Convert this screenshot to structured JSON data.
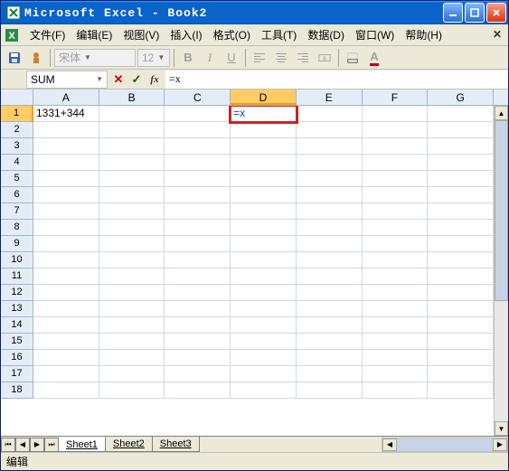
{
  "window": {
    "title": "Microsoft Excel - Book2"
  },
  "menu": {
    "file": "文件(F)",
    "edit": "编辑(E)",
    "view": "视图(V)",
    "insert": "插入(I)",
    "format": "格式(O)",
    "tools": "工具(T)",
    "data": "数据(D)",
    "windowm": "窗口(W)",
    "help": "帮助(H)"
  },
  "toolbar": {
    "font_name": "宋体",
    "font_size": "12",
    "bold": "B",
    "italic": "I",
    "underlinel": "U",
    "fontA": "A"
  },
  "formulabar": {
    "namebox": "SUM",
    "cancel": "✕",
    "accept": "✓",
    "fx": "fx",
    "formula": "=x"
  },
  "columns": [
    "A",
    "B",
    "C",
    "D",
    "E",
    "F",
    "G"
  ],
  "rows": [
    1,
    2,
    3,
    4,
    5,
    6,
    7,
    8,
    9,
    10,
    11,
    12,
    13,
    14,
    15,
    16,
    17,
    18
  ],
  "cells": {
    "A1": "1331+344",
    "D1": "=x"
  },
  "active_cell": "D1",
  "sheets": {
    "tabs": [
      "Sheet1",
      "Sheet2",
      "Sheet3"
    ],
    "active": 0
  },
  "nav": {
    "first": "⏮",
    "prev": "◀",
    "next": "▶",
    "last": "⏭"
  },
  "status": {
    "mode": "编辑"
  }
}
